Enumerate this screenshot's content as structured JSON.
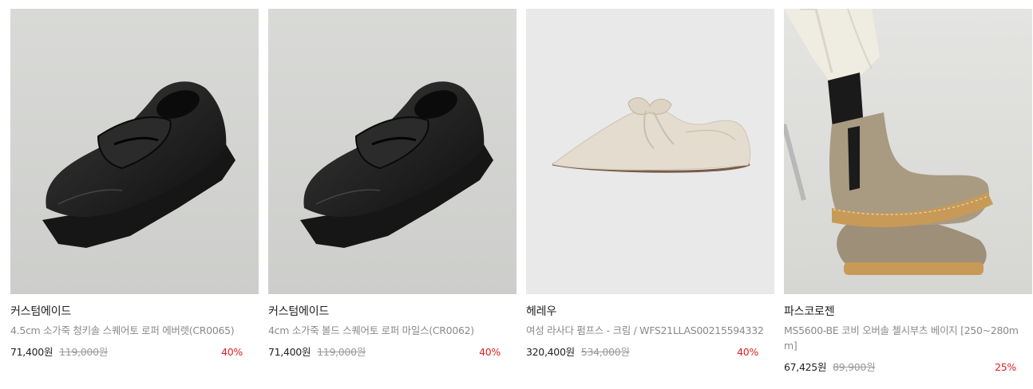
{
  "products": [
    {
      "brand": "커스텀에이드",
      "title": "4.5cm 소가죽 청키솔 스퀘어토 로퍼 에버렛(CR0065)",
      "price": "71,400원",
      "original_price": "119,000원",
      "discount": "40%"
    },
    {
      "brand": "커스텀에이드",
      "title": "4cm 소가죽 볼드 스퀘어토 로퍼 마일스(CR0062)",
      "price": "71,400원",
      "original_price": "119,000원",
      "discount": "40%"
    },
    {
      "brand": "헤레우",
      "title": "여성 라사다 펌프스 - 크림 / WFS21LLAS00215594332",
      "price": "320,400원",
      "original_price": "534,000원",
      "discount": "40%"
    },
    {
      "brand": "파스코로젠",
      "title": "MS5600-BE 코비 오버솔 첼시부츠 베이지 [250~280mm]",
      "price": "67,425원",
      "original_price": "89,900원",
      "discount": "25%"
    }
  ],
  "colors": {
    "discount": "#e02020",
    "price": "#222222",
    "muted": "#8a8a8a"
  },
  "icons": [
    "loafer-image",
    "loafer-image",
    "flat-pump-image",
    "chelsea-boot-image"
  ]
}
